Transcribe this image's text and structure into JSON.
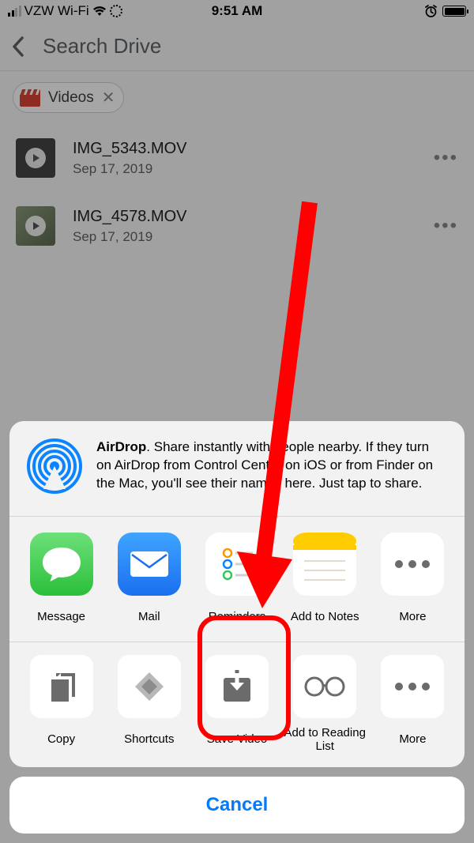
{
  "status": {
    "carrier": "VZW Wi-Fi",
    "time": "9:51 AM"
  },
  "nav": {
    "title": "Search Drive"
  },
  "chip": {
    "label": "Videos"
  },
  "files": [
    {
      "name": "IMG_5343.MOV",
      "date": "Sep 17, 2019"
    },
    {
      "name": "IMG_4578.MOV",
      "date": "Sep 17, 2019"
    }
  ],
  "airdrop": {
    "bold": "AirDrop",
    "text": ". Share instantly with people nearby. If they turn on AirDrop from Control Center on iOS or from Finder on the Mac, you'll see their names here. Just tap to share."
  },
  "apps": [
    {
      "label": "Message"
    },
    {
      "label": "Mail"
    },
    {
      "label": "Reminders"
    },
    {
      "label": "Add to Notes"
    },
    {
      "label": "More"
    }
  ],
  "actions": [
    {
      "label": "Copy"
    },
    {
      "label": "Shortcuts"
    },
    {
      "label": "Save Video"
    },
    {
      "label": "Add to Reading List"
    },
    {
      "label": "More"
    }
  ],
  "cancel": "Cancel"
}
